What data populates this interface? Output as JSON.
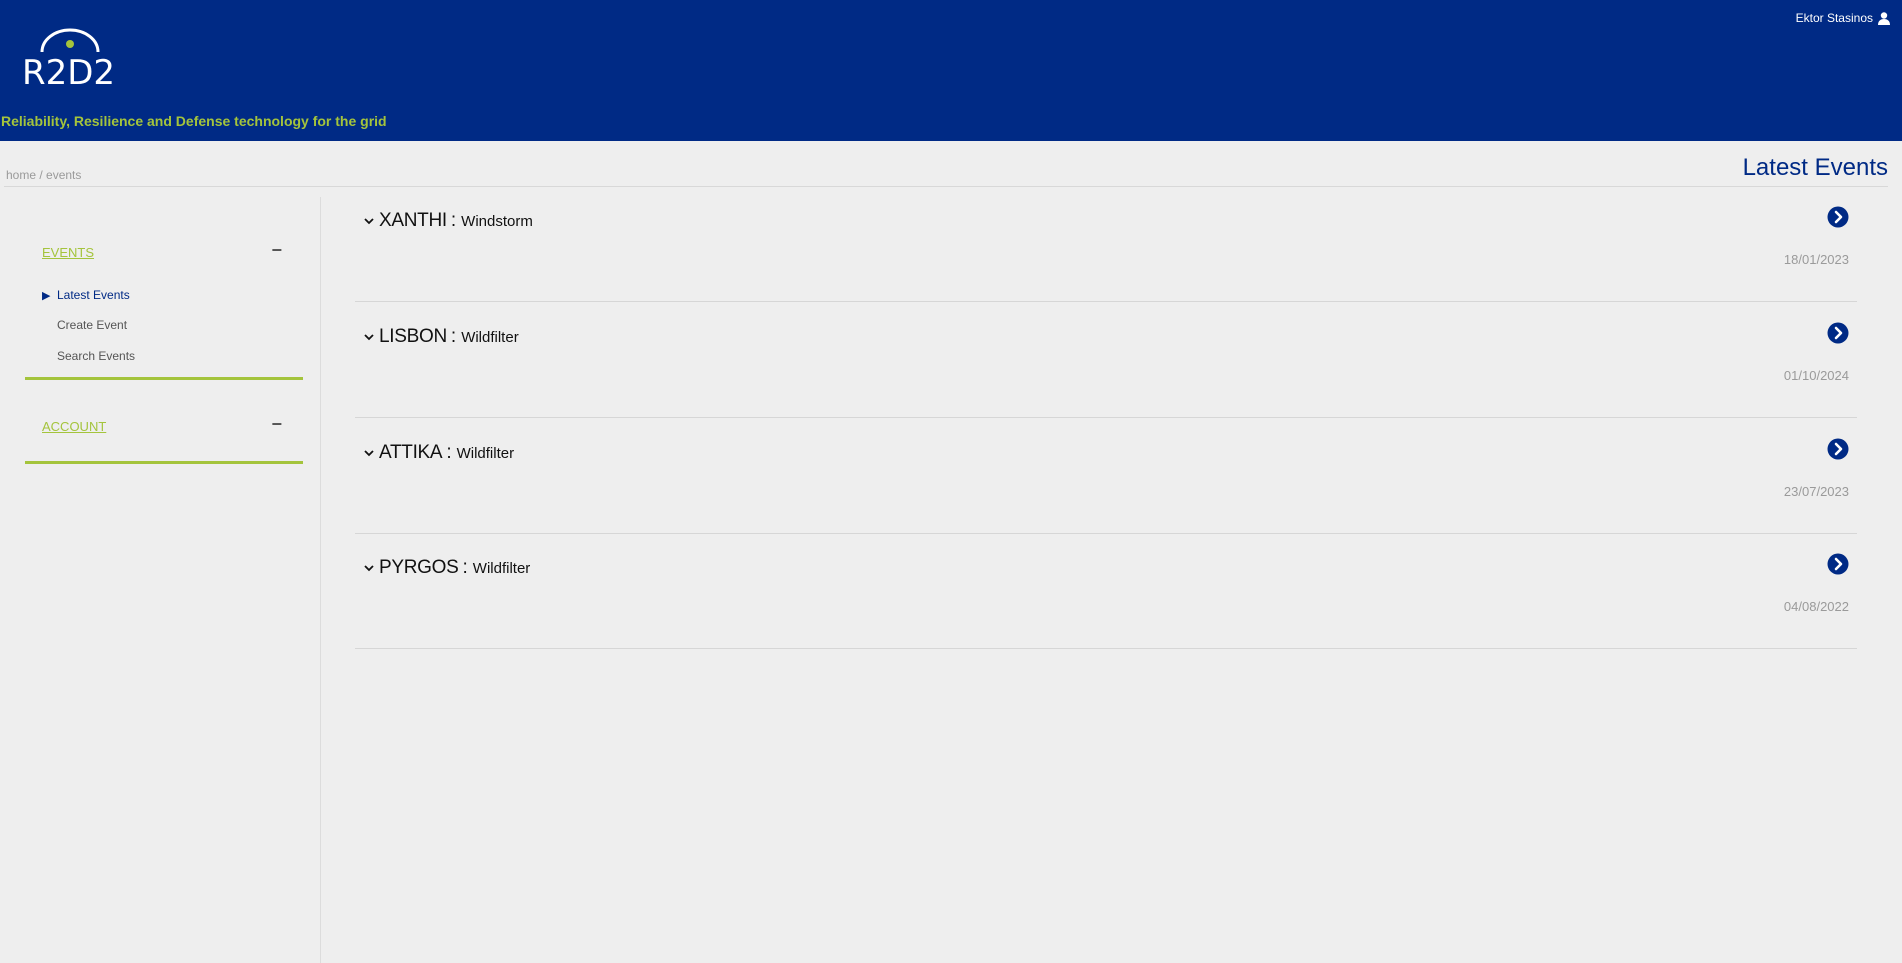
{
  "header": {
    "logo_text": "R2D2",
    "tagline": "Reliability, Resilience and Defense technology for the grid",
    "user_name": "Ektor Stasinos",
    "user_icon": "user-icon",
    "background_color": "#002a85",
    "accent_color": "#a4c43c"
  },
  "breadcrumb": "home / events",
  "page_title": "Latest Events",
  "sidebar": {
    "sections": [
      {
        "label": "EVENTS",
        "toggle": "−",
        "items": [
          {
            "label": "Latest Events",
            "active": true,
            "marker": "▶"
          },
          {
            "label": "Create Event",
            "active": false
          },
          {
            "label": "Search Events",
            "active": false
          }
        ]
      },
      {
        "label": "ACCOUNT",
        "toggle": "−",
        "items": []
      }
    ]
  },
  "events": [
    {
      "city": "XANTHI",
      "separator": ":",
      "type": "Windstorm",
      "date": "18/01/2023"
    },
    {
      "city": "LISBON",
      "separator": ":",
      "type": "Wildfilter",
      "date": "01/10/2024"
    },
    {
      "city": "ATTIKA",
      "separator": ":",
      "type": "Wildfilter",
      "date": "23/07/2023"
    },
    {
      "city": "PYRGOS",
      "separator": ":",
      "type": "Wildfilter",
      "date": "04/08/2022"
    }
  ]
}
